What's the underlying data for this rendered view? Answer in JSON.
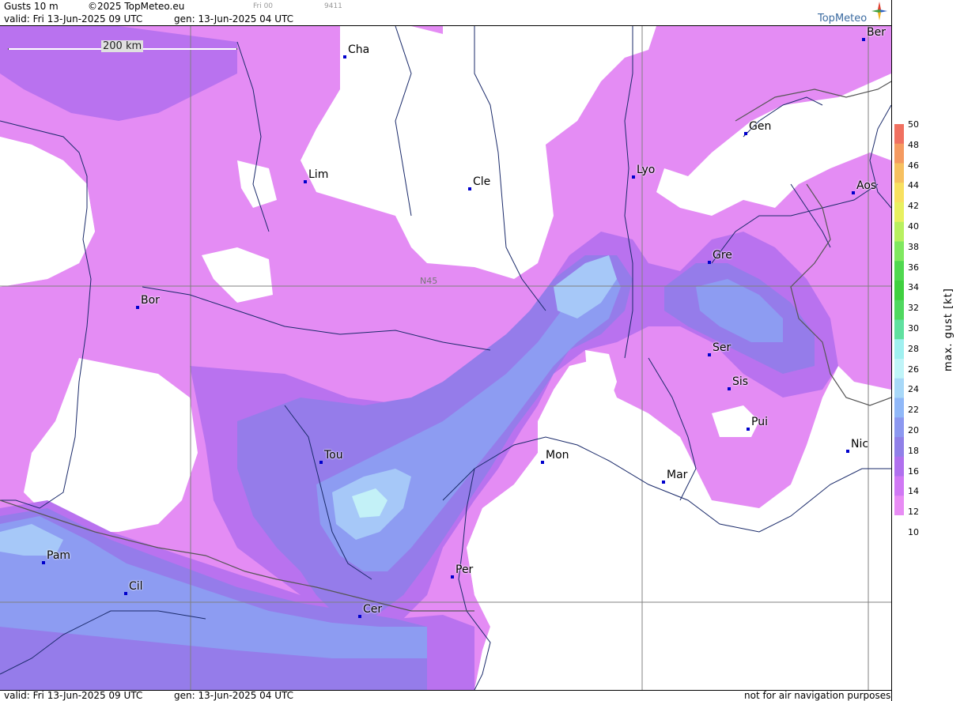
{
  "header": {
    "product": "Gusts 10 m",
    "copyright": "©2025 TopMeteo.eu",
    "step": "Fri 00",
    "code": "9411",
    "valid": "valid:  Fri  13-Jun-2025  09 UTC",
    "gen": "gen: 13-Jun-2025 04 UTC"
  },
  "logo": {
    "text": "TopMeteo",
    "icon": "compass-star-icon"
  },
  "scale_bar": {
    "label": "200 km"
  },
  "grid_label": "N45",
  "cities": [
    {
      "name": "Cha"
    },
    {
      "name": "Ber"
    },
    {
      "name": "Gen"
    },
    {
      "name": "Lim"
    },
    {
      "name": "Cle"
    },
    {
      "name": "Lyo"
    },
    {
      "name": "Aos"
    },
    {
      "name": "Gre"
    },
    {
      "name": "Bor"
    },
    {
      "name": "Ser"
    },
    {
      "name": "Sis"
    },
    {
      "name": "Pui"
    },
    {
      "name": "Nic"
    },
    {
      "name": "Tou"
    },
    {
      "name": "Mon"
    },
    {
      "name": "Mar"
    },
    {
      "name": "Pam"
    },
    {
      "name": "Cil"
    },
    {
      "name": "Per"
    },
    {
      "name": "Cer"
    }
  ],
  "legend": {
    "title": "max. gust [kt]",
    "ticks": [
      "50",
      "48",
      "46",
      "44",
      "42",
      "40",
      "38",
      "36",
      "34",
      "32",
      "30",
      "28",
      "26",
      "24",
      "22",
      "20",
      "18",
      "16",
      "14",
      "12",
      "10"
    ],
    "colors": [
      "#f07060",
      "#f59a60",
      "#f7c060",
      "#f8e060",
      "#e8f060",
      "#b8f060",
      "#80e860",
      "#50d850",
      "#40d040",
      "#50d860",
      "#60e0a0",
      "#a0f0f0",
      "#c0f4f8",
      "#a8d8f8",
      "#90b8f8",
      "#8c98f0",
      "#9080e8",
      "#b070ee",
      "#d078f4",
      "#e88cf4"
    ]
  },
  "footer": {
    "valid": "valid:  Fri  13-Jun-2025  09 UTC",
    "gen": "gen: 13-Jun-2025 04 UTC",
    "disclaimer": "not for air navigation purposes"
  }
}
